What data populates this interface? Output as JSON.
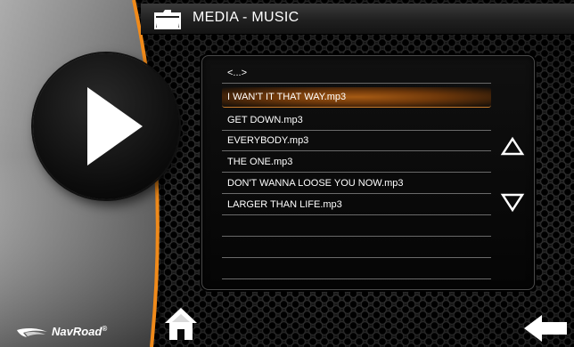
{
  "header": {
    "title": "MEDIA - MUSIC",
    "icon": "folder-icon"
  },
  "player": {
    "play_icon": "play-icon"
  },
  "file_list": {
    "items": [
      {
        "label": "<...>",
        "selected": false
      },
      {
        "label": "I WAN'T IT THAT WAY.mp3",
        "selected": true
      },
      {
        "label": "GET DOWN.mp3",
        "selected": false
      },
      {
        "label": "EVERYBODY.mp3",
        "selected": false
      },
      {
        "label": "THE ONE.mp3",
        "selected": false
      },
      {
        "label": "DON'T WANNA LOOSE YOU NOW.mp3",
        "selected": false
      },
      {
        "label": "LARGER THAN LIFE.mp3",
        "selected": false
      },
      {
        "label": "",
        "selected": false
      },
      {
        "label": "",
        "selected": false
      },
      {
        "label": "",
        "selected": false
      }
    ],
    "scroll_up_icon": "triangle-up-icon",
    "scroll_down_icon": "triangle-down-icon"
  },
  "footer": {
    "brand": "NavRoad",
    "brand_mark": "®",
    "home_icon": "home-icon",
    "back_icon": "back-arrow-icon"
  },
  "colors": {
    "accent": "#f08a1a",
    "selection": "#a85a12",
    "text": "#ffffff"
  }
}
